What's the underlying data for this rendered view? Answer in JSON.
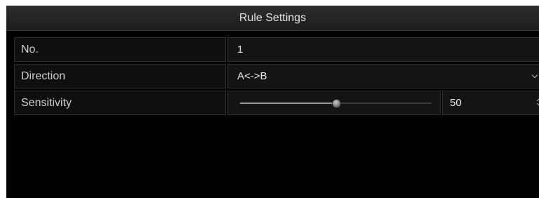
{
  "dialog": {
    "title": "Rule Settings"
  },
  "rules": [
    {
      "label": "No.",
      "value": "1"
    },
    {
      "label": "Direction",
      "value": "A<->B",
      "icon": "chevron-down-icon"
    },
    {
      "label": "Sensitivity",
      "slider_percent": 50,
      "value": "50",
      "icon": "spin-icon"
    }
  ],
  "colors": {
    "background": "#000000",
    "title_bar": "#262626",
    "cell_border": "#2f2f2f",
    "text": "#e8e8e8",
    "label_text": "#cfcfcf"
  }
}
